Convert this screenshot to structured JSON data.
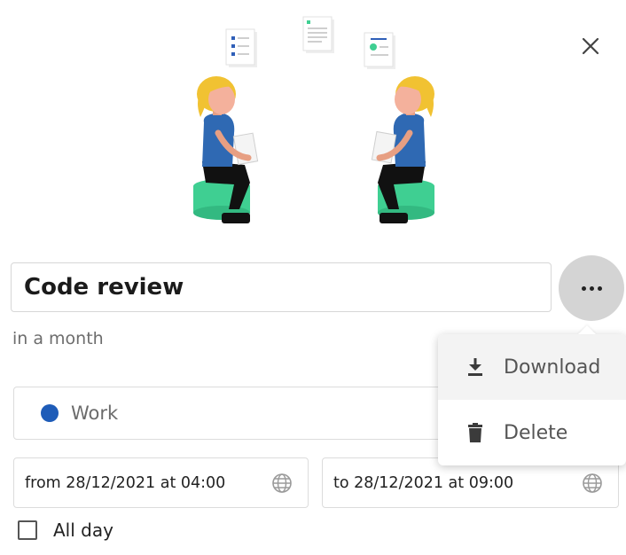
{
  "event": {
    "title": "Code review",
    "relative_time": "in a month",
    "calendar": {
      "name": "Work",
      "color": "#1e5cb8"
    },
    "start": "from 28/12/2021 at 04:00",
    "end": "to 28/12/2021 at 09:00",
    "all_day_label": "All day"
  },
  "actions_menu": {
    "items": [
      {
        "label": "Download",
        "icon": "download-icon"
      },
      {
        "label": "Delete",
        "icon": "trash-icon"
      }
    ]
  },
  "icons": {
    "close": "close-icon",
    "more": "more-horizontal-icon",
    "timezone": "globe-icon"
  },
  "colors": {
    "accent": "#1e5cb8",
    "illustration_shirt": "#2f69b3",
    "illustration_hair": "#f1c232",
    "illustration_seat": "#3fcf92"
  }
}
